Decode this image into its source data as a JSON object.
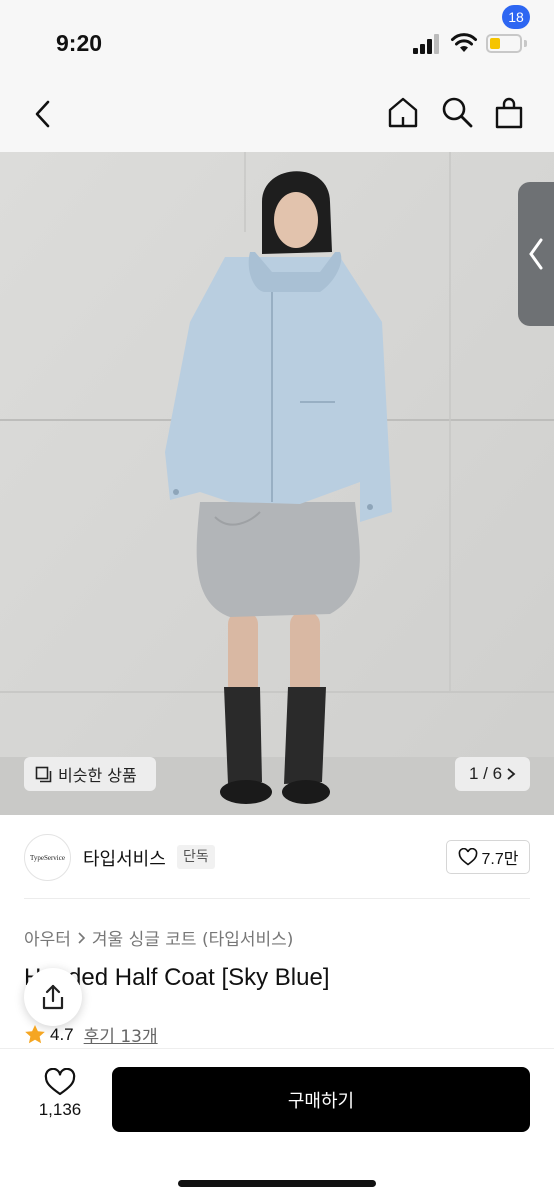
{
  "status": {
    "time": "9:20",
    "battery_level": 0.35
  },
  "header": {
    "cart_count": "18",
    "icons": [
      "back-icon",
      "home-icon",
      "search-icon",
      "cart-icon"
    ]
  },
  "gallery": {
    "similar_label": "비슷한 상품",
    "counter": "1 / 6"
  },
  "brand": {
    "logo_text": "TypeService",
    "name": "타입서비스",
    "tag": "단독",
    "likes": "7.7만"
  },
  "product": {
    "breadcrumb": [
      "아우터",
      "겨울 싱글 코트 (타입서비스)"
    ],
    "title": "Hooded Half Coat [Sky Blue]",
    "rating": "4.7",
    "review_label": "후기 13개"
  },
  "bottom": {
    "wish_count": "1,136",
    "buy_label": "구매하기"
  },
  "colors": {
    "accent": "#2d66f2",
    "buy": "#000000",
    "star": "#f5a623",
    "battery": "#f5c400"
  }
}
